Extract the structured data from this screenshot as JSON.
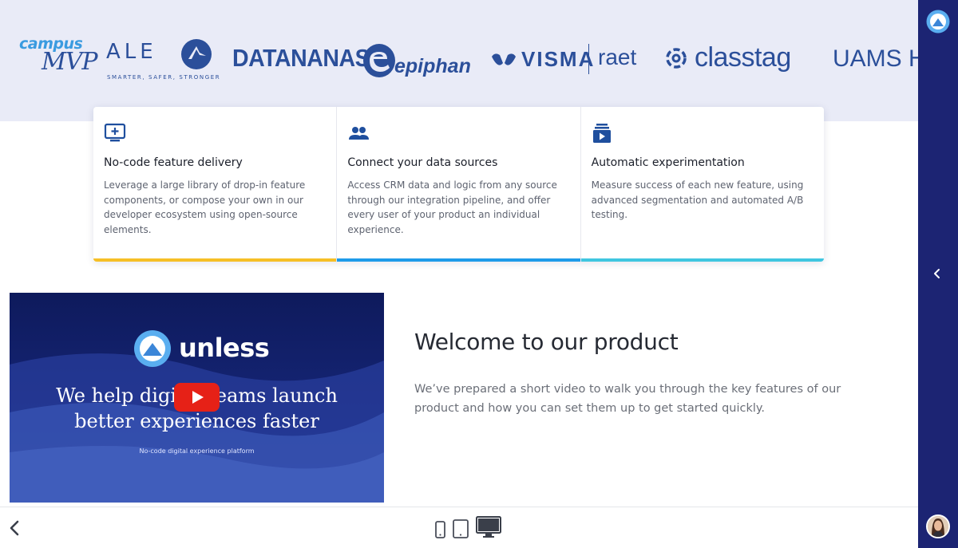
{
  "logos": {
    "campus_mvp": {
      "line1": "campus",
      "line2": "MVP"
    },
    "ale": {
      "name": "ALE",
      "tagline": "SMARTER, SAFER, STRONGER"
    },
    "datananas": "DATANANAS",
    "epiphan": "epiphan",
    "visma": {
      "name": "VISMA",
      "partner": "raet"
    },
    "classtag": "classtag",
    "uams": "UAMS H"
  },
  "features": [
    {
      "icon": "monitor-plus-icon",
      "title": "No-code feature delivery",
      "description": "Leverage a large library of drop-in feature components, or compose your own in our developer ecosystem using open-source elements.",
      "accent": "#f6bf26"
    },
    {
      "icon": "users-icon",
      "title": "Connect your data sources",
      "description": "Access CRM data and logic from any source through our integration pipeline, and offer every user of your product an individual experience.",
      "accent": "#1e9be9"
    },
    {
      "icon": "video-library-icon",
      "title": "Automatic experimentation",
      "description": "Measure success of each new feature, using advanced segmentation and automated A/B testing.",
      "accent": "#3fc6e0"
    }
  ],
  "video": {
    "brand": "unless",
    "headline_line1": "We help digital teams launch",
    "headline_line2": "better experiences faster",
    "subtitle": "No-code digital experience platform"
  },
  "welcome": {
    "title": "Welcome to our product",
    "body": "We’ve prepared a short video to walk you through the key features of our product and how you can set them up to get started quickly."
  },
  "toolbar": {
    "devices": [
      "phone-icon",
      "tablet-icon",
      "desktop-icon"
    ],
    "selected_device": "desktop"
  },
  "colors": {
    "sidebar": "#1c2473",
    "logo_strip": "#e9ebf7",
    "brand_blue": "#2b4f9a"
  }
}
